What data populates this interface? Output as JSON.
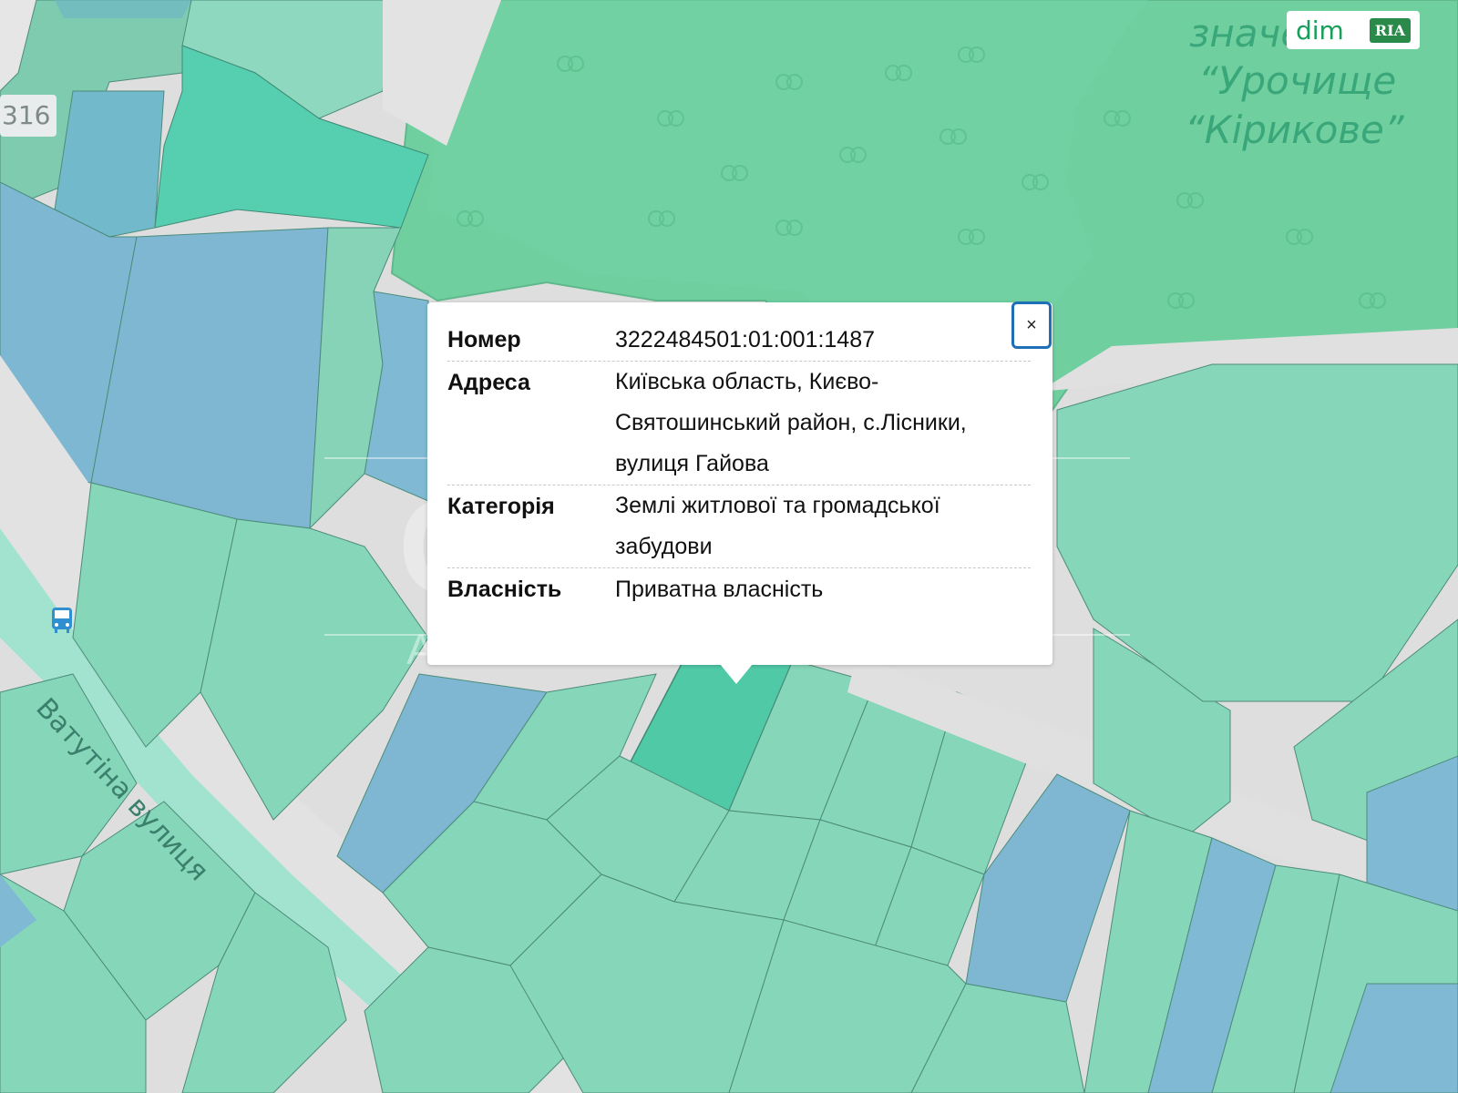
{
  "map": {
    "park_label_lines": [
      "значе",
      "“Урочище",
      "“Кірикове”"
    ],
    "road_name": "Ватутіна вулиця",
    "road_number": "316",
    "bus_stop_icon": "bus-icon"
  },
  "watermarks": {
    "site_brand": "dim",
    "site_brand_badge": "RIA",
    "agency_name": "CAPITAL",
    "agency_tagline": "АГЕНТСТВО НЕРУХОМОСТІ"
  },
  "popup": {
    "close_label": "×",
    "close_icon": "close-icon",
    "rows": [
      {
        "key": "Номер",
        "value": "3222484501:01:001:1487"
      },
      {
        "key": "Адреса",
        "value": "Київська область, Києво-Святошинський район, с.Лісники, вулиця Гайова"
      },
      {
        "key": "Категорія",
        "value": "Землі житлової та громадської забудови"
      },
      {
        "key": "Власність",
        "value": "Приватна власність"
      }
    ]
  },
  "colors": {
    "forest": "#6fcf9f",
    "parcel_green": "#86d6b9",
    "parcel_blue": "#7fb9d4",
    "selected_parcel": "#4fc9a6",
    "road": "#e0e0e0",
    "close_border": "#1f6fb8"
  }
}
